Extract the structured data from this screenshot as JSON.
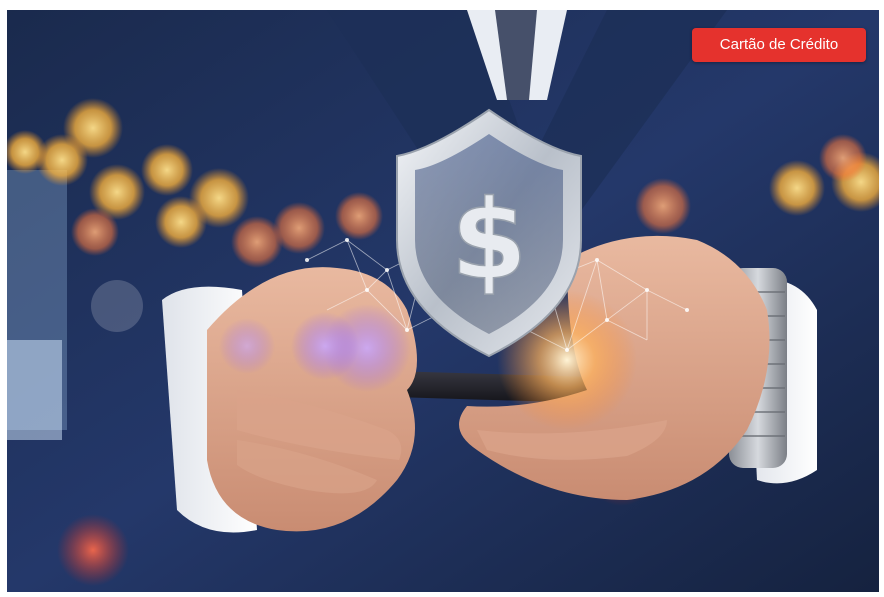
{
  "article": {
    "category_label": "Cartão de Crédito",
    "image_subject": "shield-dollar-icon"
  },
  "colors": {
    "badge_background": "#e5322d",
    "badge_text": "#ffffff",
    "suit_navy": "#1c2d52",
    "shield_silver": "#d9dde3",
    "bokeh_gold": "#ffb53a"
  }
}
